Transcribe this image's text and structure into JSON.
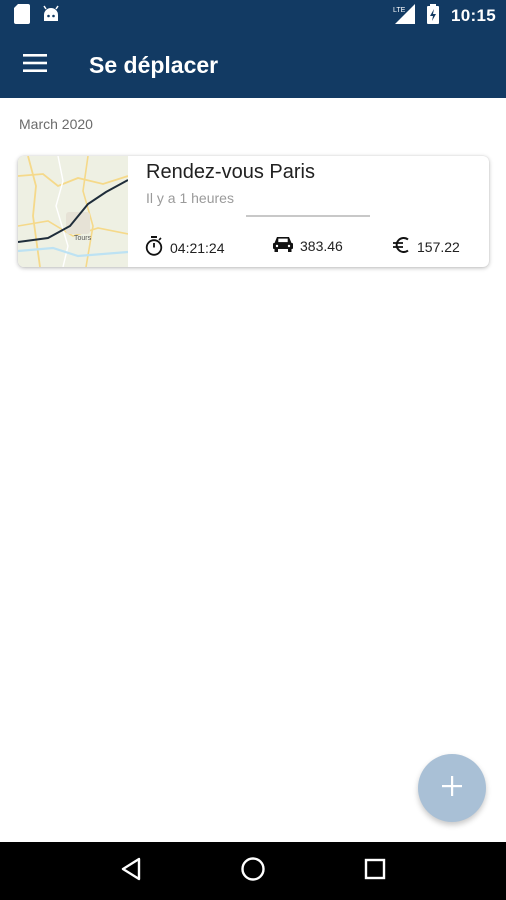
{
  "status_bar": {
    "time": "10:15",
    "network": "LTE",
    "icons": [
      "sd-card-icon",
      "android-icon",
      "lte-signal-icon",
      "battery-charging-icon"
    ]
  },
  "app_bar": {
    "title": "Se déplacer",
    "menu_icon": "menu-icon"
  },
  "section": {
    "header": "March 2020"
  },
  "trips": [
    {
      "title": "Rendez-vous Paris",
      "subtitle": "Il y a 1 heures",
      "duration": "04:21:24",
      "distance": "383.46",
      "cost": "157.22",
      "map_label": "Tours"
    }
  ],
  "fab": {
    "icon": "plus-icon"
  },
  "nav_bar": {
    "icons": [
      "back-icon",
      "home-icon",
      "recents-icon"
    ]
  },
  "colors": {
    "primary": "#123a63",
    "fab": "#a9c0d6",
    "map_bg": "#eef0e3",
    "route": "#1f2d3a"
  }
}
